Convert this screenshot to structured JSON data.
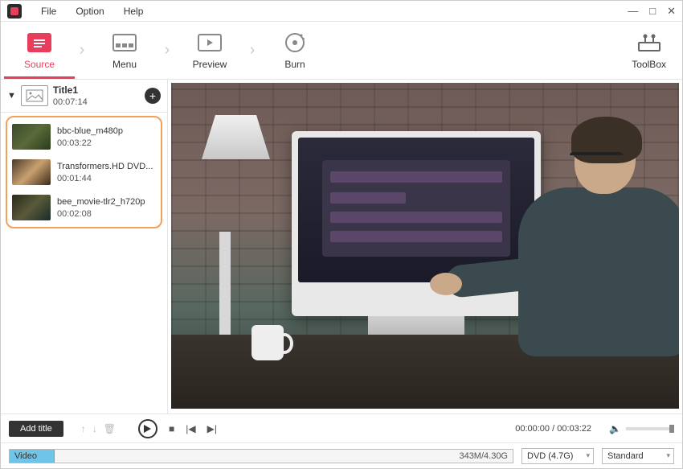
{
  "menubar": {
    "file": "File",
    "option": "Option",
    "help": "Help"
  },
  "tabs": {
    "source": "Source",
    "menu": "Menu",
    "preview": "Preview",
    "burn": "Burn",
    "toolbox": "ToolBox"
  },
  "title_group": {
    "name": "Title1",
    "duration": "00:07:14"
  },
  "clips": [
    {
      "name": "bbc-blue_m480p",
      "duration": "00:03:22"
    },
    {
      "name": "Transformers.HD DVD...",
      "duration": "00:01:44"
    },
    {
      "name": "bee_movie-tlr2_h720p",
      "duration": "00:02:08"
    }
  ],
  "controls": {
    "add_title": "Add title",
    "time_current": "00:00:00",
    "time_total": "00:03:22"
  },
  "status": {
    "track_label": "Video",
    "size": "343M/4.30G",
    "disc": "DVD (4.7G)",
    "quality": "Standard"
  },
  "colors": {
    "accent": "#e83e5b",
    "highlight_border": "#f5a05a"
  }
}
